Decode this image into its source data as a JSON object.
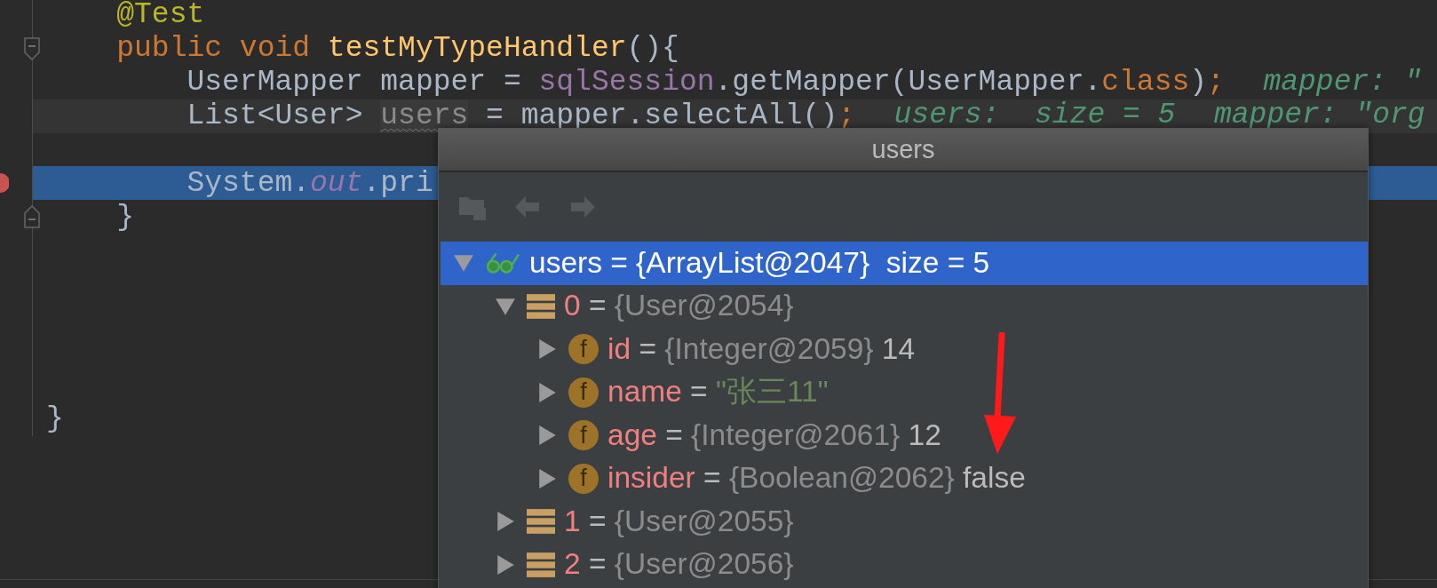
{
  "editor": {
    "lines": [
      {
        "kind": "plain",
        "tokens": [
          {
            "text": "    @Test",
            "kind": "annotation"
          }
        ]
      },
      {
        "kind": "plain",
        "marker": {
          "kind": "fold-start"
        },
        "tokens": [
          {
            "text": "    public void ",
            "kind": "keyword"
          },
          {
            "text": "testMyTypeHandler",
            "kind": "method"
          },
          {
            "text": "(){",
            "kind": "plain"
          }
        ]
      },
      {
        "kind": "plain",
        "tokens": [
          {
            "text": "        UserMapper mapper = ",
            "kind": "plain"
          },
          {
            "text": "sqlSession",
            "kind": "field"
          },
          {
            "text": ".getMapper(UserMapper.",
            "kind": "plain"
          },
          {
            "text": "class",
            "kind": "keyword"
          },
          {
            "text": ")",
            "kind": "plain"
          },
          {
            "text": ";",
            "kind": "keyword"
          }
        ],
        "hints": [
          "mapper: \""
        ]
      },
      {
        "kind": "caret",
        "tokens": [
          {
            "text": "        List<User> ",
            "kind": "plain"
          },
          {
            "text": "users",
            "kind": "unused"
          },
          {
            "text": " = mapper.selectAll()",
            "kind": "plain"
          },
          {
            "text": ";",
            "kind": "keyword"
          }
        ],
        "hints": [
          "users:  size = 5",
          "mapper: \"org"
        ]
      },
      {
        "kind": "plain"
      },
      {
        "kind": "execution",
        "marker": {
          "kind": "breakpoint"
        },
        "tokens": [
          {
            "text": "        System.",
            "kind": "plain"
          },
          {
            "text": "out",
            "kind": "static"
          },
          {
            "text": ".pri",
            "kind": "plain"
          }
        ]
      },
      {
        "kind": "plain",
        "marker": {
          "kind": "fold-end"
        },
        "tokens": [
          {
            "text": "    }",
            "kind": "plain"
          }
        ]
      },
      {
        "kind": "plain"
      },
      {
        "kind": "plain"
      },
      {
        "kind": "plain"
      },
      {
        "kind": "plain"
      },
      {
        "kind": "plain"
      },
      {
        "kind": "plain",
        "tokens": [
          {
            "text": "}",
            "kind": "plain"
          }
        ]
      }
    ]
  },
  "popup": {
    "title": "users",
    "toolbar": [
      {
        "kind": "folder",
        "disabled": true
      },
      {
        "kind": "back",
        "disabled": true
      },
      {
        "kind": "forward",
        "disabled": true
      }
    ],
    "tree": [
      {
        "kind": "watch",
        "name": "users",
        "sep": "=",
        "value": "{ArrayList@2047}",
        "extra": "size = 5",
        "expanded": true,
        "selected": true,
        "children": [
          {
            "kind": "element",
            "name": "0",
            "sep": "=",
            "value": "{User@2054}",
            "expanded": true,
            "selected": false,
            "children": [
              {
                "kind": "field",
                "badge": "f",
                "name": "id",
                "sep": "=",
                "value": "{Integer@2059}",
                "extra": "14",
                "expanded": false,
                "selected": false
              },
              {
                "kind": "field",
                "badge": "f",
                "name": "name",
                "sep": "=",
                "string_value": "\"张三11\"",
                "expanded": false,
                "selected": false
              },
              {
                "kind": "field",
                "badge": "f",
                "name": "age",
                "sep": "=",
                "value": "{Integer@2061}",
                "extra": "12",
                "expanded": false,
                "selected": false
              },
              {
                "kind": "field",
                "badge": "f",
                "name": "insider",
                "sep": "=",
                "value": "{Boolean@2062}",
                "extra": "false",
                "expanded": false,
                "selected": false
              }
            ]
          },
          {
            "kind": "element",
            "name": "1",
            "sep": "=",
            "value": "{User@2055}",
            "expanded": false,
            "selected": false
          },
          {
            "kind": "element",
            "name": "2",
            "sep": "=",
            "value": "{User@2056}",
            "expanded": false,
            "selected": false
          }
        ]
      }
    ]
  }
}
